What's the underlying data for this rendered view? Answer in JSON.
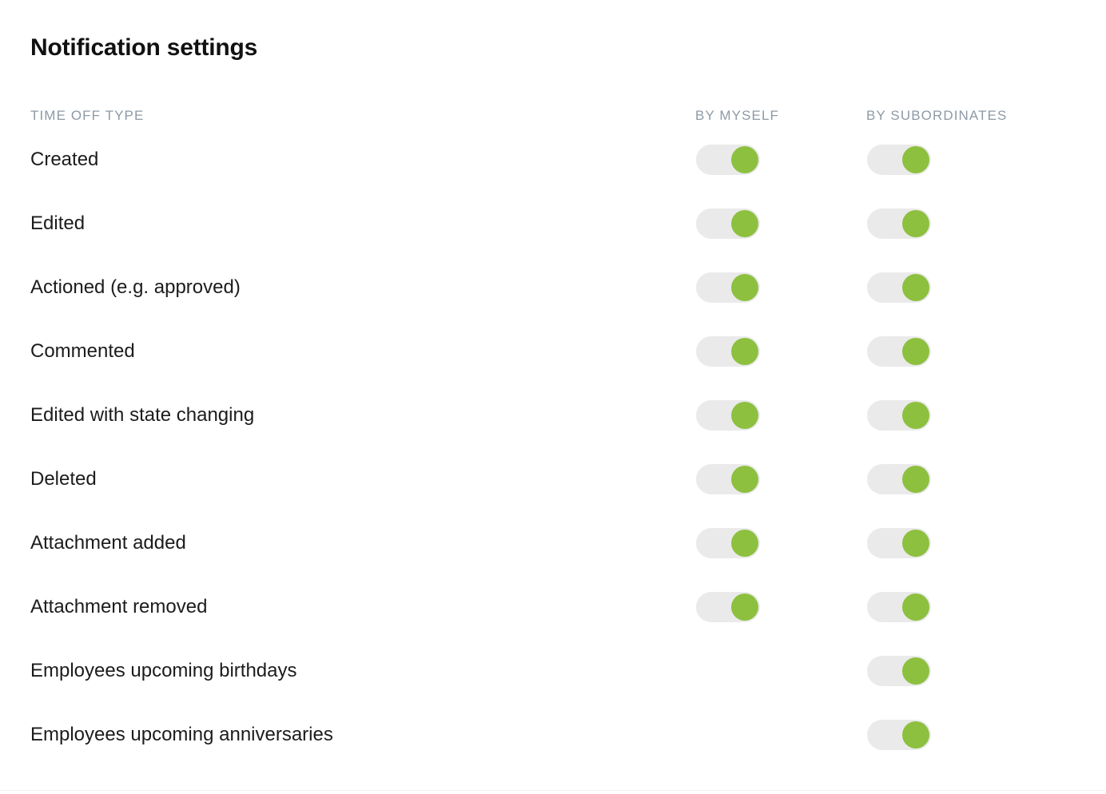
{
  "page": {
    "title": "Notification settings"
  },
  "table": {
    "columns": {
      "type": "TIME OFF TYPE",
      "by_myself": "BY MYSELF",
      "by_subordinates": "BY SUBORDINATES"
    },
    "rows": [
      {
        "label": "Created",
        "by_myself": "on",
        "by_subordinates": "on"
      },
      {
        "label": "Edited",
        "by_myself": "on",
        "by_subordinates": "on"
      },
      {
        "label": "Actioned (e.g. approved)",
        "by_myself": "on",
        "by_subordinates": "on"
      },
      {
        "label": "Commented",
        "by_myself": "on",
        "by_subordinates": "on"
      },
      {
        "label": "Edited with state changing",
        "by_myself": "on",
        "by_subordinates": "on"
      },
      {
        "label": "Deleted",
        "by_myself": "on",
        "by_subordinates": "on"
      },
      {
        "label": "Attachment added",
        "by_myself": "on",
        "by_subordinates": "on"
      },
      {
        "label": "Attachment removed",
        "by_myself": "on",
        "by_subordinates": "on"
      },
      {
        "label": "Employees upcoming birthdays",
        "by_myself": "none",
        "by_subordinates": "on"
      },
      {
        "label": "Employees upcoming anniversaries",
        "by_myself": "none",
        "by_subordinates": "on"
      }
    ]
  },
  "colors": {
    "toggle_on_knob": "#8dc03f",
    "toggle_track": "#eaeaea",
    "header_text": "#8e9aa6",
    "title_text": "#111111",
    "row_text": "#1c1c1c",
    "background": "#ffffff"
  }
}
